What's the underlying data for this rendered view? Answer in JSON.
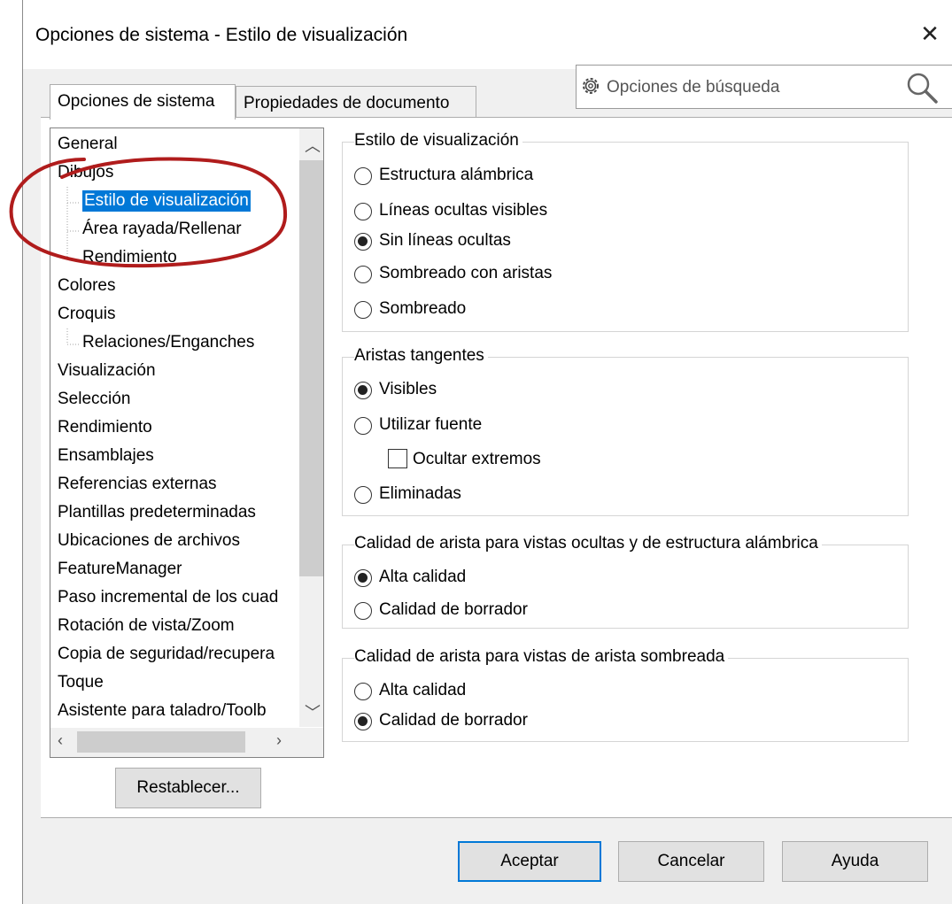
{
  "window": {
    "title": "Opciones de sistema - Estilo de visualización",
    "close_glyph": "✕"
  },
  "search": {
    "placeholder": "Opciones de búsqueda",
    "icon": "gear-icon",
    "search_icon": "magnifier-icon"
  },
  "tabs": [
    {
      "label": "Opciones de sistema",
      "active": true
    },
    {
      "label": "Propiedades de documento",
      "active": false
    }
  ],
  "tree": {
    "items": [
      {
        "label": "General",
        "level": 0
      },
      {
        "label": "Dibujos",
        "level": 0
      },
      {
        "label": "Estilo de visualización",
        "level": 1,
        "selected": true
      },
      {
        "label": "Área rayada/Rellenar",
        "level": 1
      },
      {
        "label": "Rendimiento",
        "level": 1
      },
      {
        "label": "Colores",
        "level": 0
      },
      {
        "label": "Croquis",
        "level": 0
      },
      {
        "label": "Relaciones/Enganches",
        "level": 1
      },
      {
        "label": "Visualización",
        "level": 0
      },
      {
        "label": "Selección",
        "level": 0
      },
      {
        "label": "Rendimiento",
        "level": 0
      },
      {
        "label": "Ensamblajes",
        "level": 0
      },
      {
        "label": "Referencias externas",
        "level": 0
      },
      {
        "label": "Plantillas predeterminadas",
        "level": 0
      },
      {
        "label": "Ubicaciones de archivos",
        "level": 0
      },
      {
        "label": "FeatureManager",
        "level": 0
      },
      {
        "label": "Paso incremental de los cuad",
        "level": 0
      },
      {
        "label": "Rotación de vista/Zoom",
        "level": 0
      },
      {
        "label": "Copia de seguridad/recupera",
        "level": 0
      },
      {
        "label": "Toque",
        "level": 0
      },
      {
        "label": "Asistente para taladro/Toolb",
        "level": 0
      }
    ],
    "selection_color": "#0078d7"
  },
  "groups": {
    "display_style": {
      "title": "Estilo de visualización",
      "options": [
        {
          "label": "Estructura alámbrica",
          "checked": false
        },
        {
          "label": "Líneas ocultas visibles",
          "checked": false
        },
        {
          "label": "Sin líneas ocultas",
          "checked": true
        },
        {
          "label": "Sombreado con aristas",
          "checked": false
        },
        {
          "label": "Sombreado",
          "checked": false
        }
      ]
    },
    "tangent_edges": {
      "title": "Aristas tangentes",
      "options": [
        {
          "label": "Visibles",
          "checked": true
        },
        {
          "label": "Utilizar fuente",
          "checked": false
        },
        {
          "label": "Eliminadas",
          "checked": false
        }
      ],
      "checkbox": {
        "label": "Ocultar extremos",
        "checked": false
      }
    },
    "edge_quality_hidden": {
      "title": "Calidad de arista para vistas ocultas y de estructura alámbrica",
      "options": [
        {
          "label": "Alta calidad",
          "checked": true
        },
        {
          "label": "Calidad de borrador",
          "checked": false
        }
      ]
    },
    "edge_quality_shaded": {
      "title": "Calidad de arista para vistas de arista sombreada",
      "options": [
        {
          "label": "Alta calidad",
          "checked": false
        },
        {
          "label": "Calidad de borrador",
          "checked": true
        }
      ]
    }
  },
  "buttons": {
    "reset": "Restablecer...",
    "ok": "Aceptar",
    "cancel": "Cancelar",
    "help": "Ayuda"
  },
  "annotation_color": "#b01c1c"
}
